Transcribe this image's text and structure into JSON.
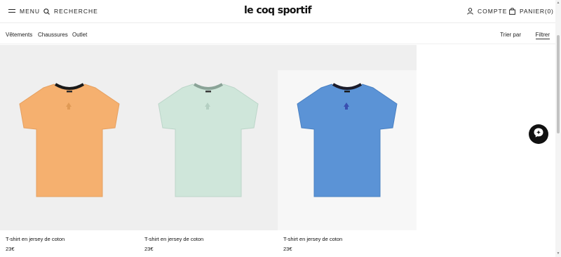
{
  "header": {
    "menu_label": "MENU",
    "search_label": "RECHERCHE",
    "logo": "le coq sportif",
    "account_label": "COMPTE",
    "cart_label": "PANIER(0)"
  },
  "subnav": {
    "categories": [
      "Vêtements",
      "Chaussures",
      "Outlet"
    ],
    "sort_label": "Trier par",
    "filter_label": "Filtrer"
  },
  "products": [
    {
      "name": "T-shirt en jersey de coton",
      "price": "23€",
      "color": "#f5b06f"
    },
    {
      "name": "T-shirt en jersey de coton",
      "price": "23€",
      "color": "#cfe6da"
    },
    {
      "name": "T-shirt en jersey de coton",
      "price": "23€",
      "color": "#5b93d6"
    }
  ],
  "icons": {
    "menu": "hamburger-icon",
    "search": "search-icon",
    "account": "user-icon",
    "cart": "bag-icon",
    "chat": "chat-icon"
  }
}
